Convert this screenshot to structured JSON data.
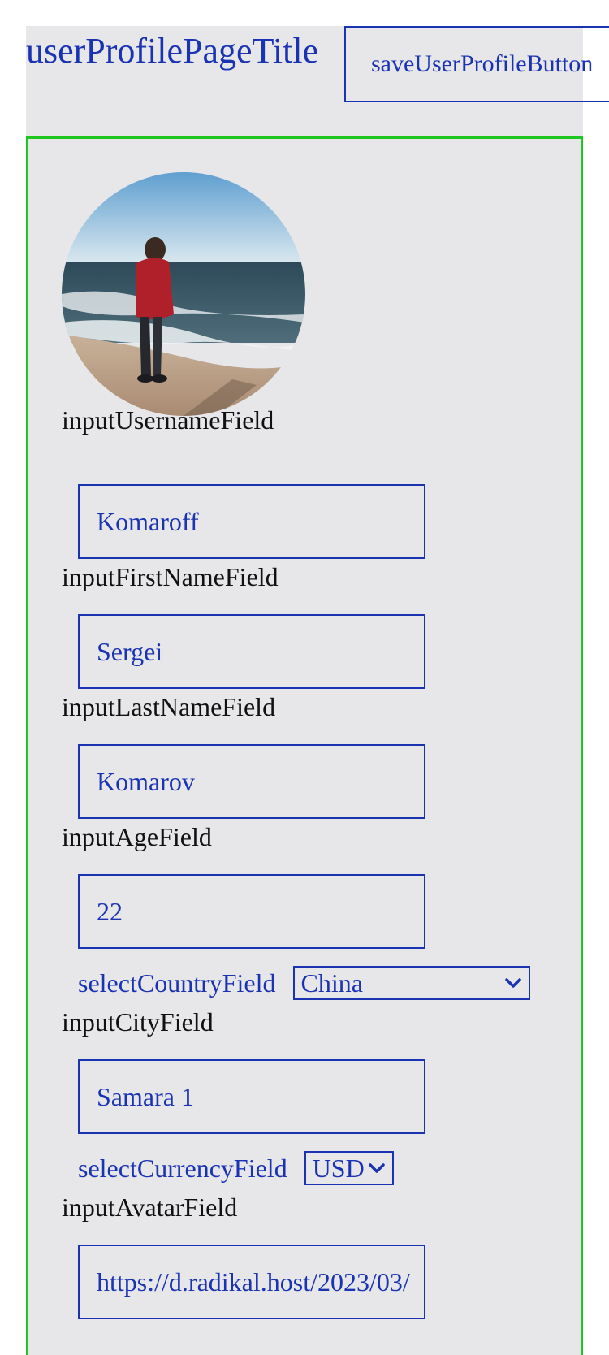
{
  "header": {
    "title": "userProfilePageTitle",
    "save_label": "saveUserProfileButton"
  },
  "profile": {
    "username": {
      "label": "inputUsernameField",
      "value": "Komaroff"
    },
    "first_name": {
      "label": "inputFirstNameField",
      "value": "Sergei"
    },
    "last_name": {
      "label": "inputLastNameField",
      "value": "Komarov"
    },
    "age": {
      "label": "inputAgeField",
      "value": "22"
    },
    "country": {
      "label": "selectCountryField",
      "value": "China"
    },
    "city": {
      "label": "inputCityField",
      "value": "Samara 1"
    },
    "currency": {
      "label": "selectCurrencyField",
      "value": "USD"
    },
    "avatar": {
      "label": "inputAvatarField",
      "value": "https://d.radikal.host/2023/03/"
    }
  },
  "colors": {
    "accent": "#1a33b3",
    "card_border": "#1ec81e",
    "background": "#e7e7ea"
  }
}
